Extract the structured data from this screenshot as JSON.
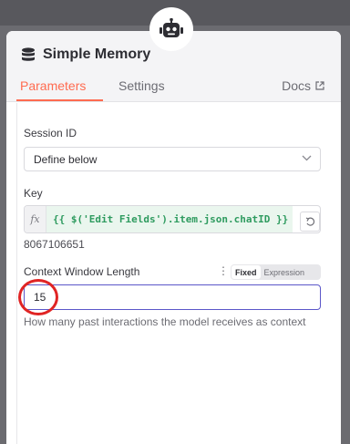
{
  "node": {
    "title": "Simple Memory",
    "icon": "database-icon",
    "badge_icon": "robot-icon"
  },
  "tabs": [
    {
      "label": "Parameters",
      "active": true
    },
    {
      "label": "Settings",
      "active": false
    }
  ],
  "docs": {
    "label": "Docs",
    "icon": "external-link-icon"
  },
  "fields": {
    "session_id": {
      "label": "Session ID",
      "value": "Define below"
    },
    "key": {
      "label": "Key",
      "fx_label": "fx",
      "expression": "{{ $('Edit Fields').item.json.chatID }}",
      "resolved_value": "8067106651"
    },
    "context_window": {
      "label": "Context Window Length",
      "mode_options": [
        "Fixed",
        "Expression"
      ],
      "selected_mode": "Fixed",
      "value": "15",
      "help": "How many past interactions the model receives as context"
    }
  },
  "colors": {
    "accent": "#ff6b50",
    "focus_border": "#5b57c9",
    "highlight": "#e02424",
    "expression_text": "#2e9b5f"
  }
}
